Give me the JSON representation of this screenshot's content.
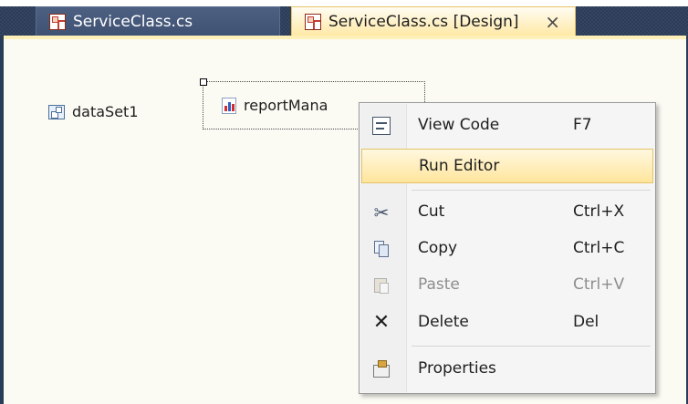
{
  "tabs": [
    {
      "label": "ServiceClass.cs",
      "icon": "cs-document-icon",
      "active": false
    },
    {
      "label": "ServiceClass.cs [Design]",
      "icon": "design-document-icon",
      "active": true,
      "close_glyph": "×"
    }
  ],
  "designer": {
    "components": [
      {
        "label": "dataSet1",
        "icon": "dataset-icon"
      },
      {
        "label": "reportMana",
        "icon": "report-manager-icon"
      }
    ]
  },
  "context_menu": {
    "items": [
      {
        "label": "View Code",
        "shortcut": "F7",
        "icon": "view-code-icon"
      },
      {
        "label": "Run Editor",
        "shortcut": "",
        "icon": "",
        "highlighted": true
      },
      {
        "label": "Cut",
        "shortcut": "Ctrl+X",
        "icon": "scissors-icon"
      },
      {
        "label": "Copy",
        "shortcut": "Ctrl+C",
        "icon": "copy-icon"
      },
      {
        "label": "Paste",
        "shortcut": "Ctrl+V",
        "icon": "paste-icon",
        "disabled": true
      },
      {
        "label": "Delete",
        "shortcut": "Del",
        "icon": "delete-icon"
      },
      {
        "label": "Properties",
        "shortcut": "",
        "icon": "properties-icon"
      }
    ]
  },
  "colors": {
    "tab_strip": "#2b3c59",
    "active_tab": "#ffe9a6",
    "menu_highlight": "#ffe59c",
    "designer_background": "#fbfaf3"
  }
}
